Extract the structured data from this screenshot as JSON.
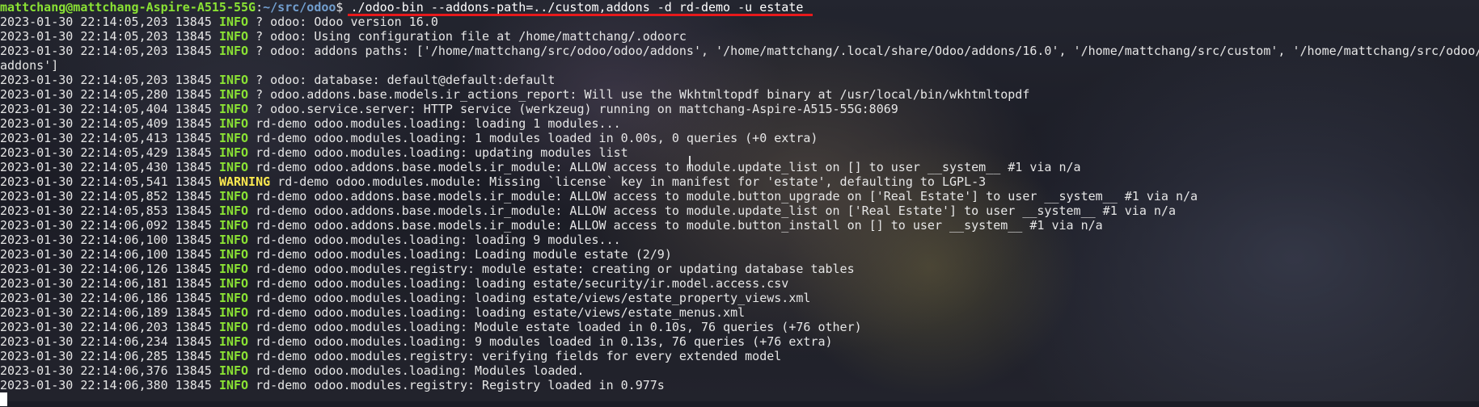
{
  "prompt": {
    "user_host": "mattchang@mattchang-Aspire-A515-55G",
    "path": "~/src/odoo",
    "symbol": "$ ",
    "command": "./odoo-bin --addons-path=../custom,addons -d rd-demo -u estate"
  },
  "colors": {
    "prompt_user": "#8ae234",
    "prompt_path": "#729fcf",
    "info": "#8ae234",
    "warning": "#fce94f",
    "underline": "#e8191b"
  },
  "log": [
    {
      "ts": "2023-01-30 22:14:05,203",
      "pid": "13845",
      "level": "INFO",
      "msg": "? odoo: Odoo version 16.0"
    },
    {
      "ts": "2023-01-30 22:14:05,203",
      "pid": "13845",
      "level": "INFO",
      "msg": "? odoo: Using configuration file at /home/mattchang/.odoorc"
    },
    {
      "ts": "2023-01-30 22:14:05,203",
      "pid": "13845",
      "level": "INFO",
      "msg": "? odoo: addons paths: ['/home/mattchang/src/odoo/odoo/addons', '/home/mattchang/.local/share/Odoo/addons/16.0', '/home/mattchang/src/custom', '/home/mattchang/src/odoo/"
    },
    {
      "ts": "",
      "pid": "",
      "level": "",
      "msg": "addons']"
    },
    {
      "ts": "2023-01-30 22:14:05,203",
      "pid": "13845",
      "level": "INFO",
      "msg": "? odoo: database: default@default:default"
    },
    {
      "ts": "2023-01-30 22:14:05,280",
      "pid": "13845",
      "level": "INFO",
      "msg": "? odoo.addons.base.models.ir_actions_report: Will use the Wkhtmltopdf binary at /usr/local/bin/wkhtmltopdf"
    },
    {
      "ts": "2023-01-30 22:14:05,404",
      "pid": "13845",
      "level": "INFO",
      "msg": "? odoo.service.server: HTTP service (werkzeug) running on mattchang-Aspire-A515-55G:8069"
    },
    {
      "ts": "2023-01-30 22:14:05,409",
      "pid": "13845",
      "level": "INFO",
      "msg": "rd-demo odoo.modules.loading: loading 1 modules..."
    },
    {
      "ts": "2023-01-30 22:14:05,413",
      "pid": "13845",
      "level": "INFO",
      "msg": "rd-demo odoo.modules.loading: 1 modules loaded in 0.00s, 0 queries (+0 extra)"
    },
    {
      "ts": "2023-01-30 22:14:05,429",
      "pid": "13845",
      "level": "INFO",
      "msg": "rd-demo odoo.modules.loading: updating modules list"
    },
    {
      "ts": "2023-01-30 22:14:05,430",
      "pid": "13845",
      "level": "INFO",
      "msg": "rd-demo odoo.addons.base.models.ir_module: ALLOW access to module.update_list on [] to user __system__ #1 via n/a"
    },
    {
      "ts": "2023-01-30 22:14:05,541",
      "pid": "13845",
      "level": "WARNING",
      "msg": "rd-demo odoo.modules.module: Missing `license` key in manifest for 'estate', defaulting to LGPL-3"
    },
    {
      "ts": "2023-01-30 22:14:05,852",
      "pid": "13845",
      "level": "INFO",
      "msg": "rd-demo odoo.addons.base.models.ir_module: ALLOW access to module.button_upgrade on ['Real Estate'] to user __system__ #1 via n/a"
    },
    {
      "ts": "2023-01-30 22:14:05,853",
      "pid": "13845",
      "level": "INFO",
      "msg": "rd-demo odoo.addons.base.models.ir_module: ALLOW access to module.update_list on ['Real Estate'] to user __system__ #1 via n/a"
    },
    {
      "ts": "2023-01-30 22:14:06,092",
      "pid": "13845",
      "level": "INFO",
      "msg": "rd-demo odoo.addons.base.models.ir_module: ALLOW access to module.button_install on [] to user __system__ #1 via n/a"
    },
    {
      "ts": "2023-01-30 22:14:06,100",
      "pid": "13845",
      "level": "INFO",
      "msg": "rd-demo odoo.modules.loading: loading 9 modules..."
    },
    {
      "ts": "2023-01-30 22:14:06,100",
      "pid": "13845",
      "level": "INFO",
      "msg": "rd-demo odoo.modules.loading: Loading module estate (2/9)"
    },
    {
      "ts": "2023-01-30 22:14:06,126",
      "pid": "13845",
      "level": "INFO",
      "msg": "rd-demo odoo.modules.registry: module estate: creating or updating database tables"
    },
    {
      "ts": "2023-01-30 22:14:06,181",
      "pid": "13845",
      "level": "INFO",
      "msg": "rd-demo odoo.modules.loading: loading estate/security/ir.model.access.csv"
    },
    {
      "ts": "2023-01-30 22:14:06,186",
      "pid": "13845",
      "level": "INFO",
      "msg": "rd-demo odoo.modules.loading: loading estate/views/estate_property_views.xml"
    },
    {
      "ts": "2023-01-30 22:14:06,189",
      "pid": "13845",
      "level": "INFO",
      "msg": "rd-demo odoo.modules.loading: loading estate/views/estate_menus.xml"
    },
    {
      "ts": "2023-01-30 22:14:06,203",
      "pid": "13845",
      "level": "INFO",
      "msg": "rd-demo odoo.modules.loading: Module estate loaded in 0.10s, 76 queries (+76 other)"
    },
    {
      "ts": "2023-01-30 22:14:06,234",
      "pid": "13845",
      "level": "INFO",
      "msg": "rd-demo odoo.modules.loading: 9 modules loaded in 0.13s, 76 queries (+76 extra)"
    },
    {
      "ts": "2023-01-30 22:14:06,285",
      "pid": "13845",
      "level": "INFO",
      "msg": "rd-demo odoo.modules.registry: verifying fields for every extended model"
    },
    {
      "ts": "2023-01-30 22:14:06,376",
      "pid": "13845",
      "level": "INFO",
      "msg": "rd-demo odoo.modules.loading: Modules loaded."
    },
    {
      "ts": "2023-01-30 22:14:06,380",
      "pid": "13845",
      "level": "INFO",
      "msg": "rd-demo odoo.modules.registry: Registry loaded in 0.977s"
    }
  ]
}
